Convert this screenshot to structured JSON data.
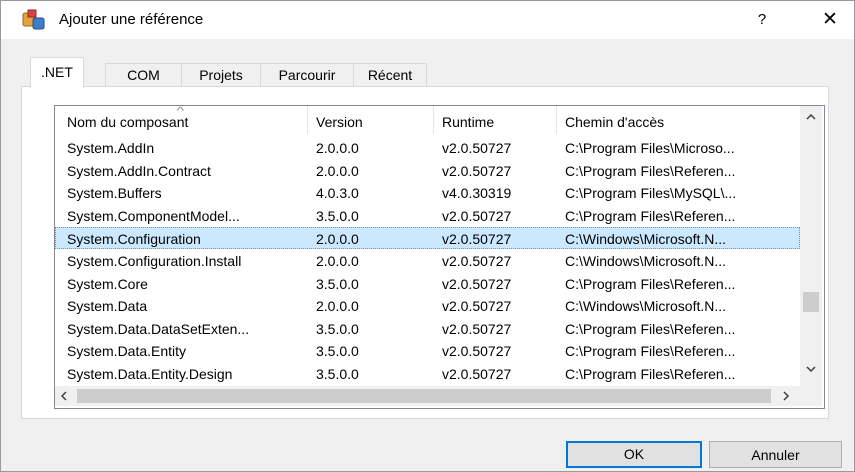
{
  "window": {
    "title": "Ajouter une référence",
    "help_label": "?",
    "close_label": "✕"
  },
  "tabs": [
    {
      "label": ".NET",
      "active": true
    },
    {
      "label": "COM",
      "active": false
    },
    {
      "label": "Projets",
      "active": false
    },
    {
      "label": "Parcourir",
      "active": false
    },
    {
      "label": "Récent",
      "active": false
    }
  ],
  "list": {
    "columns": [
      "Nom du composant",
      "Version",
      "Runtime",
      "Chemin d'accès"
    ],
    "rows": [
      {
        "name": "System.AddIn",
        "version": "2.0.0.0",
        "runtime": "v2.0.50727",
        "path": "C:\\Program Files\\Microso..."
      },
      {
        "name": "System.AddIn.Contract",
        "version": "2.0.0.0",
        "runtime": "v2.0.50727",
        "path": "C:\\Program Files\\Referen..."
      },
      {
        "name": "System.Buffers",
        "version": "4.0.3.0",
        "runtime": "v4.0.30319",
        "path": "C:\\Program Files\\MySQL\\..."
      },
      {
        "name": "System.ComponentModel...",
        "version": "3.5.0.0",
        "runtime": "v2.0.50727",
        "path": "C:\\Program Files\\Referen..."
      },
      {
        "name": "System.Configuration",
        "version": "2.0.0.0",
        "runtime": "v2.0.50727",
        "path": "C:\\Windows\\Microsoft.N...",
        "selected": true
      },
      {
        "name": "System.Configuration.Install",
        "version": "2.0.0.0",
        "runtime": "v2.0.50727",
        "path": "C:\\Windows\\Microsoft.N..."
      },
      {
        "name": "System.Core",
        "version": "3.5.0.0",
        "runtime": "v2.0.50727",
        "path": "C:\\Program Files\\Referen..."
      },
      {
        "name": "System.Data",
        "version": "2.0.0.0",
        "runtime": "v2.0.50727",
        "path": "C:\\Windows\\Microsoft.N..."
      },
      {
        "name": "System.Data.DataSetExten...",
        "version": "3.5.0.0",
        "runtime": "v2.0.50727",
        "path": "C:\\Program Files\\Referen..."
      },
      {
        "name": "System.Data.Entity",
        "version": "3.5.0.0",
        "runtime": "v2.0.50727",
        "path": "C:\\Program Files\\Referen..."
      },
      {
        "name": "System.Data.Entity.Design",
        "version": "3.5.0.0",
        "runtime": "v2.0.50727",
        "path": "C:\\Program Files\\Referen..."
      }
    ]
  },
  "buttons": {
    "ok": "OK",
    "cancel": "Annuler"
  },
  "colors": {
    "selection": "#cce8ff",
    "default_button_border": "#0078d7"
  }
}
